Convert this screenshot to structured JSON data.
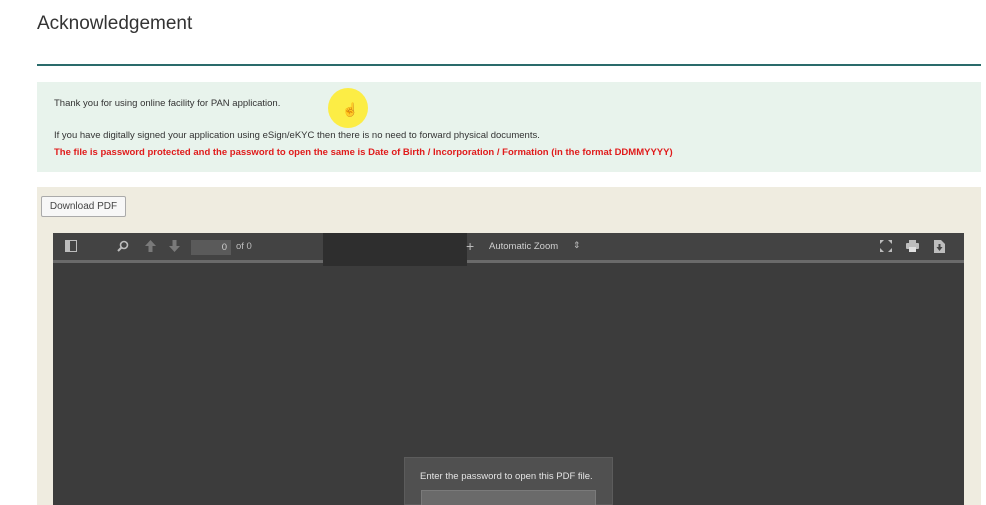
{
  "page": {
    "title": "Acknowledgement"
  },
  "notice": {
    "line1": "Thank you for using online facility for PAN application.",
    "line2": "If you have digitally signed your application using eSign/eKYC then there is no need to forward physical documents.",
    "line3": "The file is password protected and the password to open the same is Date of Birth / Incorporation / Formation (in the format DDMMYYYY)"
  },
  "actions": {
    "download_label": "Download PDF"
  },
  "viewer": {
    "page_number": "0",
    "page_count": "of 0",
    "zoom_plus": "+",
    "zoom_label": "Automatic Zoom",
    "zoom_arrow": "⇕",
    "password_prompt": "Enter the password to open this PDF file.",
    "icons": [
      "sidebar-toggle-icon",
      "search-icon",
      "previous-page-icon",
      "next-page-icon",
      "fullscreen-icon",
      "print-icon",
      "download-icon"
    ]
  },
  "colors": {
    "accent_rule": "#2a6b6b",
    "notice_bg": "#e8f3ec",
    "warning_text": "#e01b1b",
    "viewer_bg": "#3c3c3c"
  }
}
